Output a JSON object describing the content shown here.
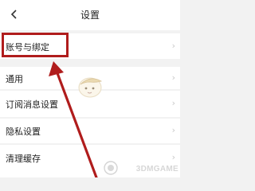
{
  "header": {
    "back_glyph": "‹",
    "title": "设置"
  },
  "settings": {
    "items": [
      {
        "label": "账号与绑定",
        "chevron": "›"
      },
      {
        "label": "通用",
        "chevron": "›"
      },
      {
        "label": "订阅消息设置",
        "chevron": "›"
      },
      {
        "label": "隐私设置",
        "chevron": "›"
      },
      {
        "label": "清理缓存",
        "chevron": "›"
      }
    ]
  },
  "watermark": {
    "text": "3DMGAME"
  },
  "colors": {
    "highlight": "#b01c1c",
    "background": "#f2f2f2"
  },
  "icons": [
    "back-chevron-icon",
    "chevron-right-icon",
    "mascot-icon",
    "3dm-logo-icon"
  ]
}
